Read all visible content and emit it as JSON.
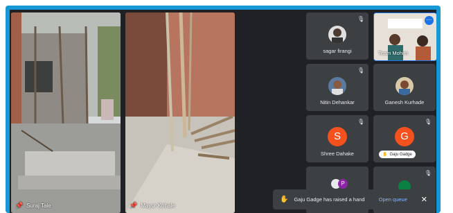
{
  "feeds": [
    {
      "name": "Suraj Tale"
    },
    {
      "name": "Mayur Kohale"
    }
  ],
  "tiles": [
    {
      "name": "sagar firangi",
      "avatar": "photo"
    },
    {
      "name": "Team Mohim",
      "avatar": "video"
    },
    {
      "name": "Nitin Dehankar",
      "avatar": "photo"
    },
    {
      "name": "Ganesh Kurhade",
      "avatar": "photo"
    },
    {
      "name": "Shree Dahake",
      "letter": "S",
      "color": "#f4511e"
    },
    {
      "name": "Gaju Gadge",
      "letter": "G",
      "color": "#f4511e",
      "badge": "Gaju Gadge"
    }
  ],
  "partial_letter": "P",
  "toast": {
    "message": "Gaju Gadge has raised a hand",
    "action": "Open queue",
    "close": "✕"
  },
  "colors": {
    "frame": "#1798d6",
    "meet_bg": "#202124",
    "tile_bg": "#3c4043",
    "link": "#8ab4f8"
  }
}
